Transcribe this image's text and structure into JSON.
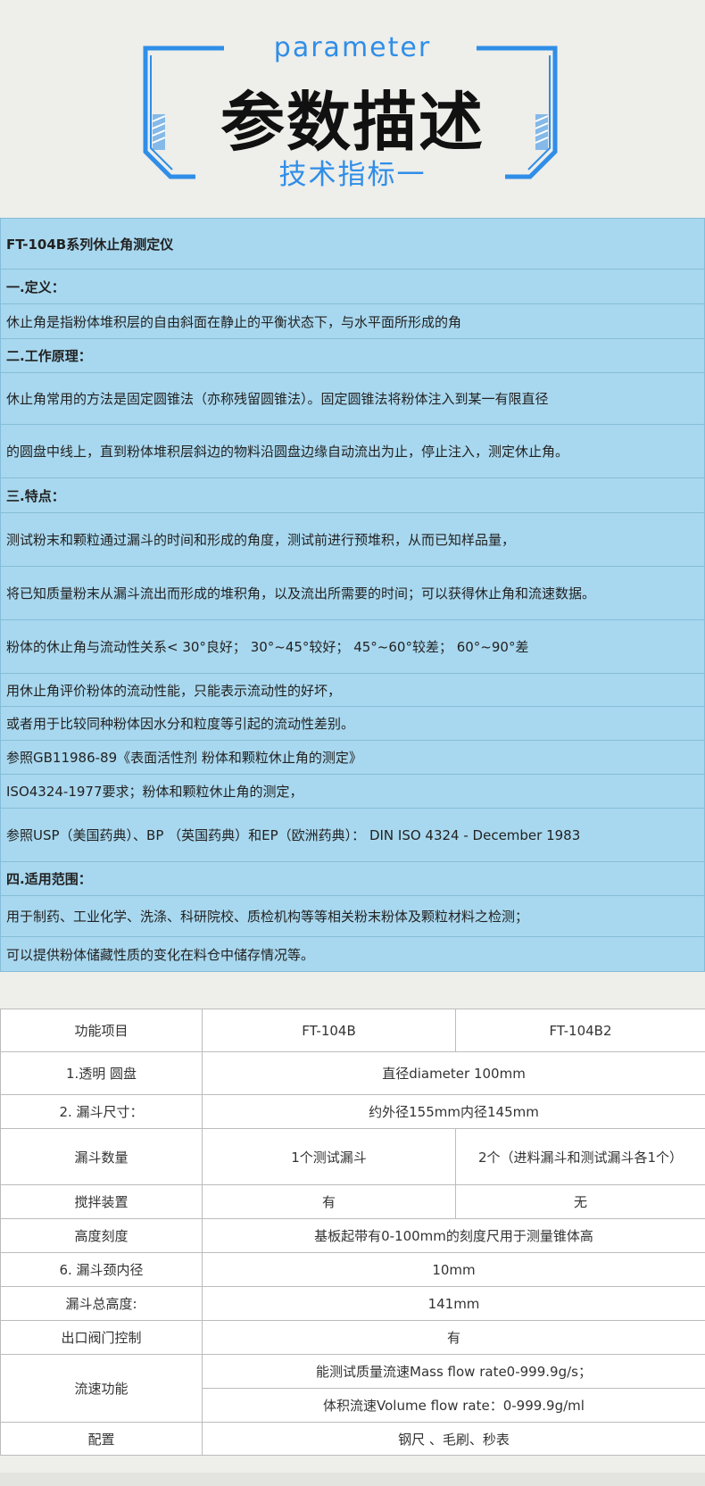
{
  "header": {
    "subtitle_en": "parameter",
    "title": "参数描述",
    "subtitle_zh": "技术指标一",
    "accent_color": "#2f8ee8"
  },
  "info": {
    "rows": [
      {
        "text": "FT-104B系列休止角测定仪",
        "bold": true
      },
      {
        "text": "一.定义：",
        "bold": true
      },
      {
        "text": "休止角是指粉体堆积层的自由斜面在静止的平衡状态下，与水平面所形成的角",
        "bold": false
      },
      {
        "text": "二.工作原理：",
        "bold": true
      },
      {
        "text": "休止角常用的方法是固定圆锥法（亦称残留圆锥法）。固定圆锥法将粉体注入到某一有限直径",
        "bold": false
      },
      {
        "text": "的圆盘中线上，直到粉体堆积层斜边的物料沿圆盘边缘自动流出为止，停止注入，测定休止角。",
        "bold": false
      },
      {
        "text": "三.特点：",
        "bold": true
      },
      {
        "text": "测试粉末和颗粒通过漏斗的时间和形成的角度，测试前进行预堆积，从而已知样品量，",
        "bold": false
      },
      {
        "text": "将已知质量粉末从漏斗流出而形成的堆积角，以及流出所需要的时间；可以获得休止角和流速数据。",
        "bold": false
      },
      {
        "text": "粉体的休止角与流动性关系< 30°良好； 30°~45°较好； 45°~60°较差； 60°~90°差",
        "bold": false
      },
      {
        "text": "用休止角评价粉体的流动性能，只能表示流动性的好坏，",
        "bold": false
      },
      {
        "text": "或者用于比较同种粉体因水分和粒度等引起的流动性差别。",
        "bold": false
      },
      {
        "text": "参照GB11986-89《表面活性剂 粉体和颗粒休止角的测定》",
        "bold": false
      },
      {
        "text": "ISO4324-1977要求；粉体和颗粒休止角的测定，",
        "bold": false
      },
      {
        "text": "参照USP（美国药典）、BP （英国药典）和EP（欧洲药典）： DIN ISO 4324 - December 1983",
        "bold": false
      },
      {
        "text": "四.适用范围：",
        "bold": true
      },
      {
        "text": "用于制药、工业化学、洗涤、科研院校、质检机构等等相关粉末粉体及颗粒材料之检测；",
        "bold": false
      },
      {
        "text": "可以提供粉体储藏性质的变化在料仓中储存情况等。",
        "bold": false
      }
    ]
  },
  "spec": {
    "header": {
      "item": "功能项目",
      "col1": "FT-104B",
      "col2": "FT-104B2"
    },
    "disc": {
      "label": "1.透明 圆盘",
      "value": "直径diameter 100mm"
    },
    "funnel_size": {
      "label": "2. 漏斗尺寸：",
      "value": "约外径155mm内径145mm"
    },
    "funnel_count": {
      "label": "漏斗数量",
      "col1": "1个测试漏斗",
      "col2": "2个（进料漏斗和测试漏斗各1个）"
    },
    "stirrer": {
      "label": "搅拌装置",
      "col1": "有",
      "col2": "无"
    },
    "height_scale": {
      "label": "高度刻度",
      "value": "基板起带有0-100mm的刻度尺用于测量锥体高"
    },
    "neck_diameter": {
      "label": "6. 漏斗颈内径",
      "value": "10mm"
    },
    "total_height": {
      "label": "漏斗总高度:",
      "value": "141mm"
    },
    "outlet_valve": {
      "label": "出口阀门控制",
      "value": "有"
    },
    "flow": {
      "label": "流速功能",
      "value1": "能测试质量流速Mass flow rate0-999.9g/s；",
      "value2": "体积流速Volume flow rate：0-999.9g/ml"
    },
    "config": {
      "label": "配置",
      "value": "钢尺 、毛刷、秒表"
    }
  }
}
